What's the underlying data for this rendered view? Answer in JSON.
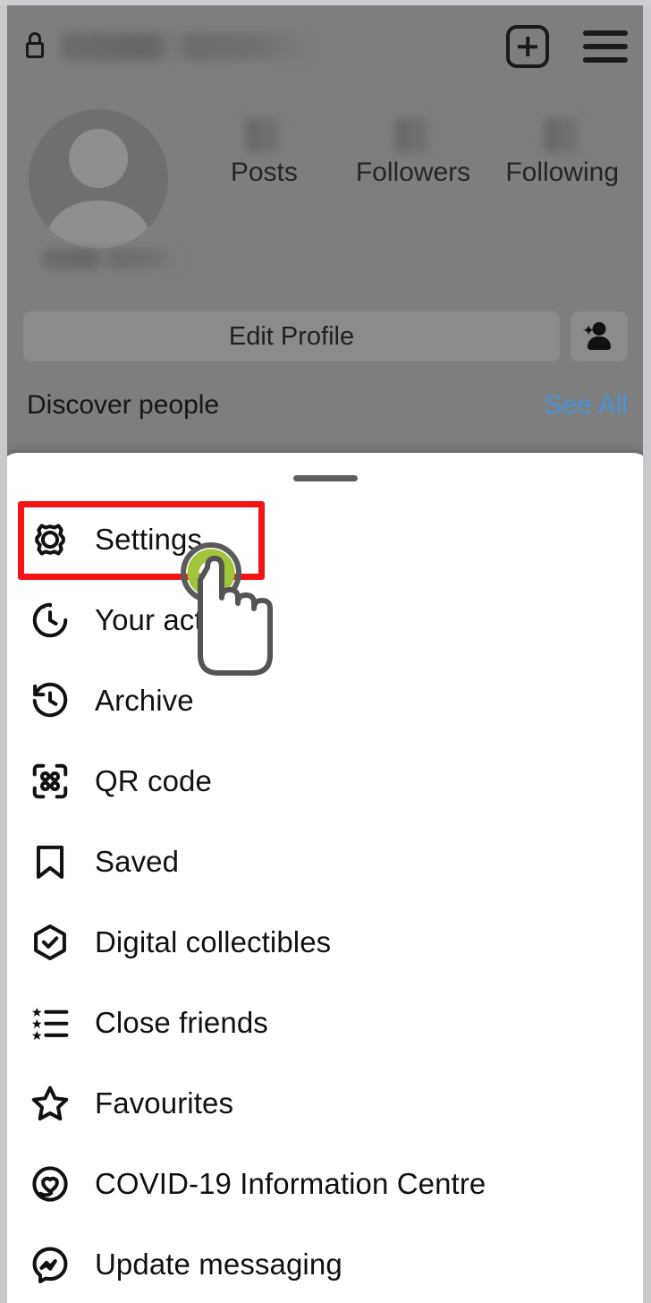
{
  "profile": {
    "topbar": {
      "lock_icon": "lock-icon",
      "username_redacted": "",
      "create_icon": "plus-square-icon",
      "menu_icon": "hamburger-menu-icon"
    },
    "avatar": {
      "icon": "avatar-placeholder",
      "display_name_redacted": ""
    },
    "stats": [
      {
        "value": "",
        "label": "Posts"
      },
      {
        "value": "",
        "label": "Followers"
      },
      {
        "value": "",
        "label": "Following"
      }
    ],
    "edit_profile_label": "Edit Profile",
    "add_person_icon": "add-person-icon",
    "discover": {
      "title": "Discover people",
      "see_all_label": "See All",
      "see_all_color": "#4a93d6"
    }
  },
  "sheet": {
    "handle": "drag-handle",
    "items": [
      {
        "label": "Settings",
        "icon": "gear-icon",
        "highlighted": true
      },
      {
        "label": "Your activity",
        "icon": "activity-clock-icon",
        "highlighted": false
      },
      {
        "label": "Archive",
        "icon": "archive-rewind-clock-icon",
        "highlighted": false
      },
      {
        "label": "QR code",
        "icon": "qr-code-icon",
        "highlighted": false
      },
      {
        "label": "Saved",
        "icon": "bookmark-icon",
        "highlighted": false
      },
      {
        "label": "Digital collectibles",
        "icon": "hexagon-check-icon",
        "highlighted": false
      },
      {
        "label": "Close friends",
        "icon": "star-list-icon",
        "highlighted": false
      },
      {
        "label": "Favourites",
        "icon": "star-icon",
        "highlighted": false
      },
      {
        "label": "COVID-19 Information Centre",
        "icon": "covid-heart-circle-icon",
        "highlighted": false
      },
      {
        "label": "Update messaging",
        "icon": "messenger-icon",
        "highlighted": false
      }
    ]
  },
  "annotation": {
    "highlight_color": "#f61313",
    "highlight_target": "Settings",
    "cursor": "tap-hand-cursor",
    "ripple_color": "#9fc53a"
  },
  "theme": {
    "overlay_gray": "#7d7e7e",
    "sheet_background": "#ffffff",
    "text_color": "#111111"
  }
}
